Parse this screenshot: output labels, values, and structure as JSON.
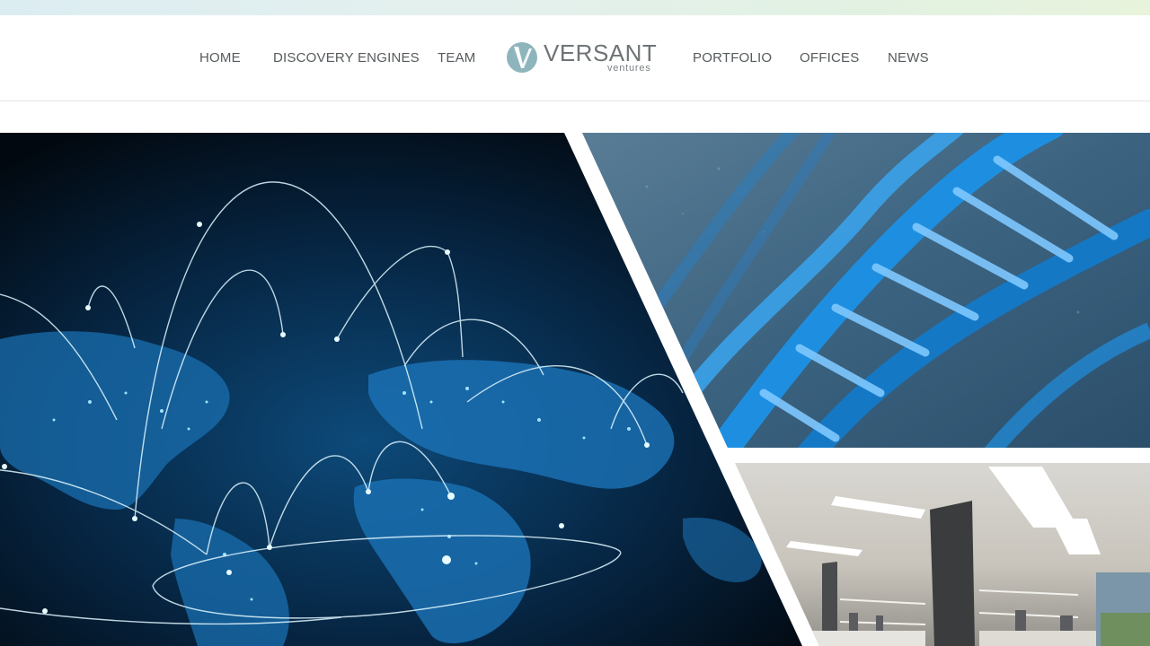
{
  "nav": {
    "items": [
      {
        "label": "HOME"
      },
      {
        "label": "DISCOVERY ENGINES"
      },
      {
        "label": "TEAM"
      },
      {
        "label": "PORTFOLIO"
      },
      {
        "label": "OFFICES"
      },
      {
        "label": "NEWS"
      }
    ]
  },
  "logo": {
    "word": "VERSANT",
    "sub": "ventures",
    "colors": {
      "mark": "#8fb5bc",
      "text": "#6e7476"
    }
  },
  "hero": {
    "panels": [
      {
        "name": "world-network-map",
        "icon": "globe-network-image"
      },
      {
        "name": "dna-helix",
        "icon": "dna-image"
      },
      {
        "name": "laboratory",
        "icon": "lab-image"
      }
    ],
    "colors": {
      "glow": "#2fa8ff",
      "deep": "#03101c",
      "dna": "#1e8fe0"
    }
  }
}
